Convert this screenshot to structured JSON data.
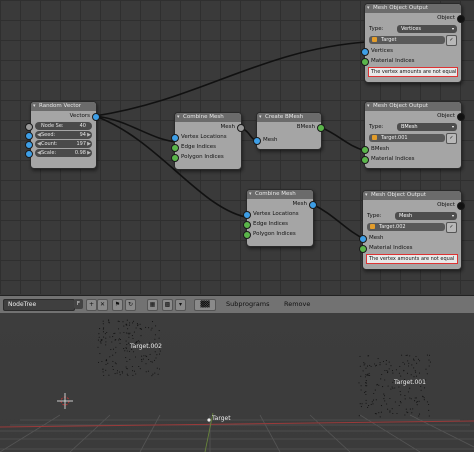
{
  "nodes": {
    "random_vector": {
      "title": "Random Vector",
      "output": "Vectors",
      "fields": [
        {
          "label": "Node Se:",
          "value": "40"
        },
        {
          "label": "Seed:",
          "value": "94"
        },
        {
          "label": "Count:",
          "value": "197"
        },
        {
          "label": "Scale:",
          "value": "0.98"
        }
      ]
    },
    "combine_mesh_1": {
      "title": "Combine Mesh",
      "output": "Mesh",
      "inputs": [
        "Vertex Locations",
        "Edge Indices",
        "Polygon Indices"
      ]
    },
    "create_bmesh": {
      "title": "Create BMesh",
      "output": "BMesh",
      "input": "Mesh"
    },
    "combine_mesh_2": {
      "title": "Combine Mesh",
      "output": "Mesh",
      "inputs": [
        "Vertex Locations",
        "Edge Indices",
        "Polygon Indices"
      ]
    },
    "mesh_output_1": {
      "title": "Mesh Object Output",
      "object_label": "Object",
      "type_label": "Type:",
      "type_value": "Vertices",
      "object_name": "Target",
      "inputs": [
        "Vertices",
        "Material Indices"
      ],
      "error": "The vertex amounts are not equal"
    },
    "mesh_output_2": {
      "title": "Mesh Object Output",
      "object_label": "Object",
      "type_label": "Type:",
      "type_value": "BMesh",
      "object_name": "Target.001",
      "inputs": [
        "BMesh",
        "Material Indices"
      ]
    },
    "mesh_output_3": {
      "title": "Mesh Object Output",
      "object_label": "Object",
      "type_label": "Type:",
      "type_value": "Mesh",
      "object_name": "Target.002",
      "inputs": [
        "Mesh",
        "Material Indices"
      ],
      "error": "The vertex amounts are not equal"
    }
  },
  "header": {
    "nodetree_name": "NodeTree",
    "fake_user": "F",
    "subprograms": "Subprograms",
    "remove": "Remove"
  },
  "viewport": {
    "objects": [
      "Target.002",
      "Target.001",
      "Target"
    ]
  },
  "colors": {
    "socket_vector": "#3d9ee6",
    "socket_mesh": "#9a9a9a",
    "socket_green": "#5ab54a",
    "error_border": "#dd3333",
    "object_icon": "#e39d2b"
  }
}
